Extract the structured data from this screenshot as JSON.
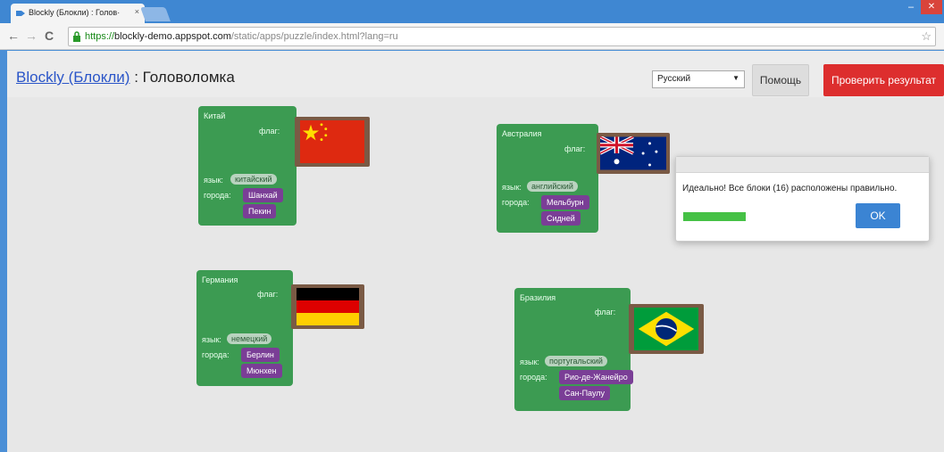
{
  "browser": {
    "tab_title": "Blockly (Блокли) : Голов·",
    "tab_close": "×",
    "url_scheme": "https://",
    "url_host": "blockly-demo.appspot.com",
    "url_path": "/static/apps/puzzle/index.html?lang=ru",
    "back_icon": "←",
    "forward_icon": "→",
    "reload_icon": "C",
    "star_icon": "☆"
  },
  "header": {
    "title_link": "Blockly (Блокли)",
    "title_sep": " : ",
    "title": "Головоломка",
    "lang_select": "Русский",
    "help_button": "Помощь",
    "check_button": "Проверить результат"
  },
  "colors": {
    "block_green": "#3c9b52",
    "city_purple": "#7a3e96",
    "check_red": "#dd2e2e",
    "ok_blue": "#3b84d3"
  },
  "blocks": {
    "china": {
      "name": "Китай",
      "flag_label": "флаг:",
      "lang_label": "язык:",
      "language": "китайский",
      "cities_label": "города:",
      "cities": [
        "Шанхай",
        "Пекин"
      ]
    },
    "australia": {
      "name": "Австралия",
      "flag_label": "флаг:",
      "lang_label": "язык:",
      "language": "английский",
      "cities_label": "города:",
      "cities": [
        "Мельбурн",
        "Сидней"
      ]
    },
    "germany": {
      "name": "Германия",
      "flag_label": "флаг:",
      "lang_label": "язык:",
      "language": "немецкий",
      "cities_label": "города:",
      "cities": [
        "Берлин",
        "Мюнхен"
      ]
    },
    "brazil": {
      "name": "Бразилия",
      "flag_label": "флаг:",
      "lang_label": "язык:",
      "language": "португальский",
      "cities_label": "города:",
      "cities": [
        "Рио-де-Жанейро",
        "Сан-Паулу"
      ]
    }
  },
  "dialog": {
    "message": "Идеально! Все блоки (16) расположены правильно.",
    "ok_button": "OK",
    "progress": 1.0
  }
}
